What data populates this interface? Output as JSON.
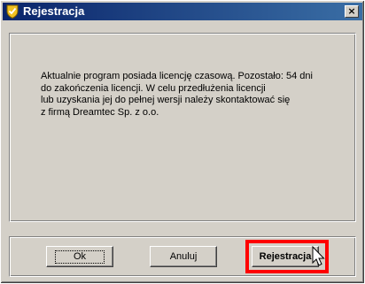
{
  "window": {
    "title": "Rejestracja",
    "close_label": "×"
  },
  "message": {
    "lines": [
      "Aktualnie program posiada licencję czasową. Pozostało: 54 dni",
      "do zakończenia licencji. W celu przedłużenia licencji",
      "lub uzyskania jej do pełnej wersji należy skontaktować się",
      "z firmą Dreamtec Sp. z o.o."
    ]
  },
  "buttons": {
    "ok_label": "Ok",
    "cancel_label": "Anuluj",
    "register_label": "Rejestracja"
  },
  "colors": {
    "titlebar_start": "#0a246a",
    "titlebar_end": "#3a6ea5",
    "highlight": "#ff0000",
    "face": "#d4d0c8"
  },
  "icons": {
    "app": "shield-check-icon",
    "close": "close-icon",
    "cursor": "mouse-pointer-icon"
  }
}
